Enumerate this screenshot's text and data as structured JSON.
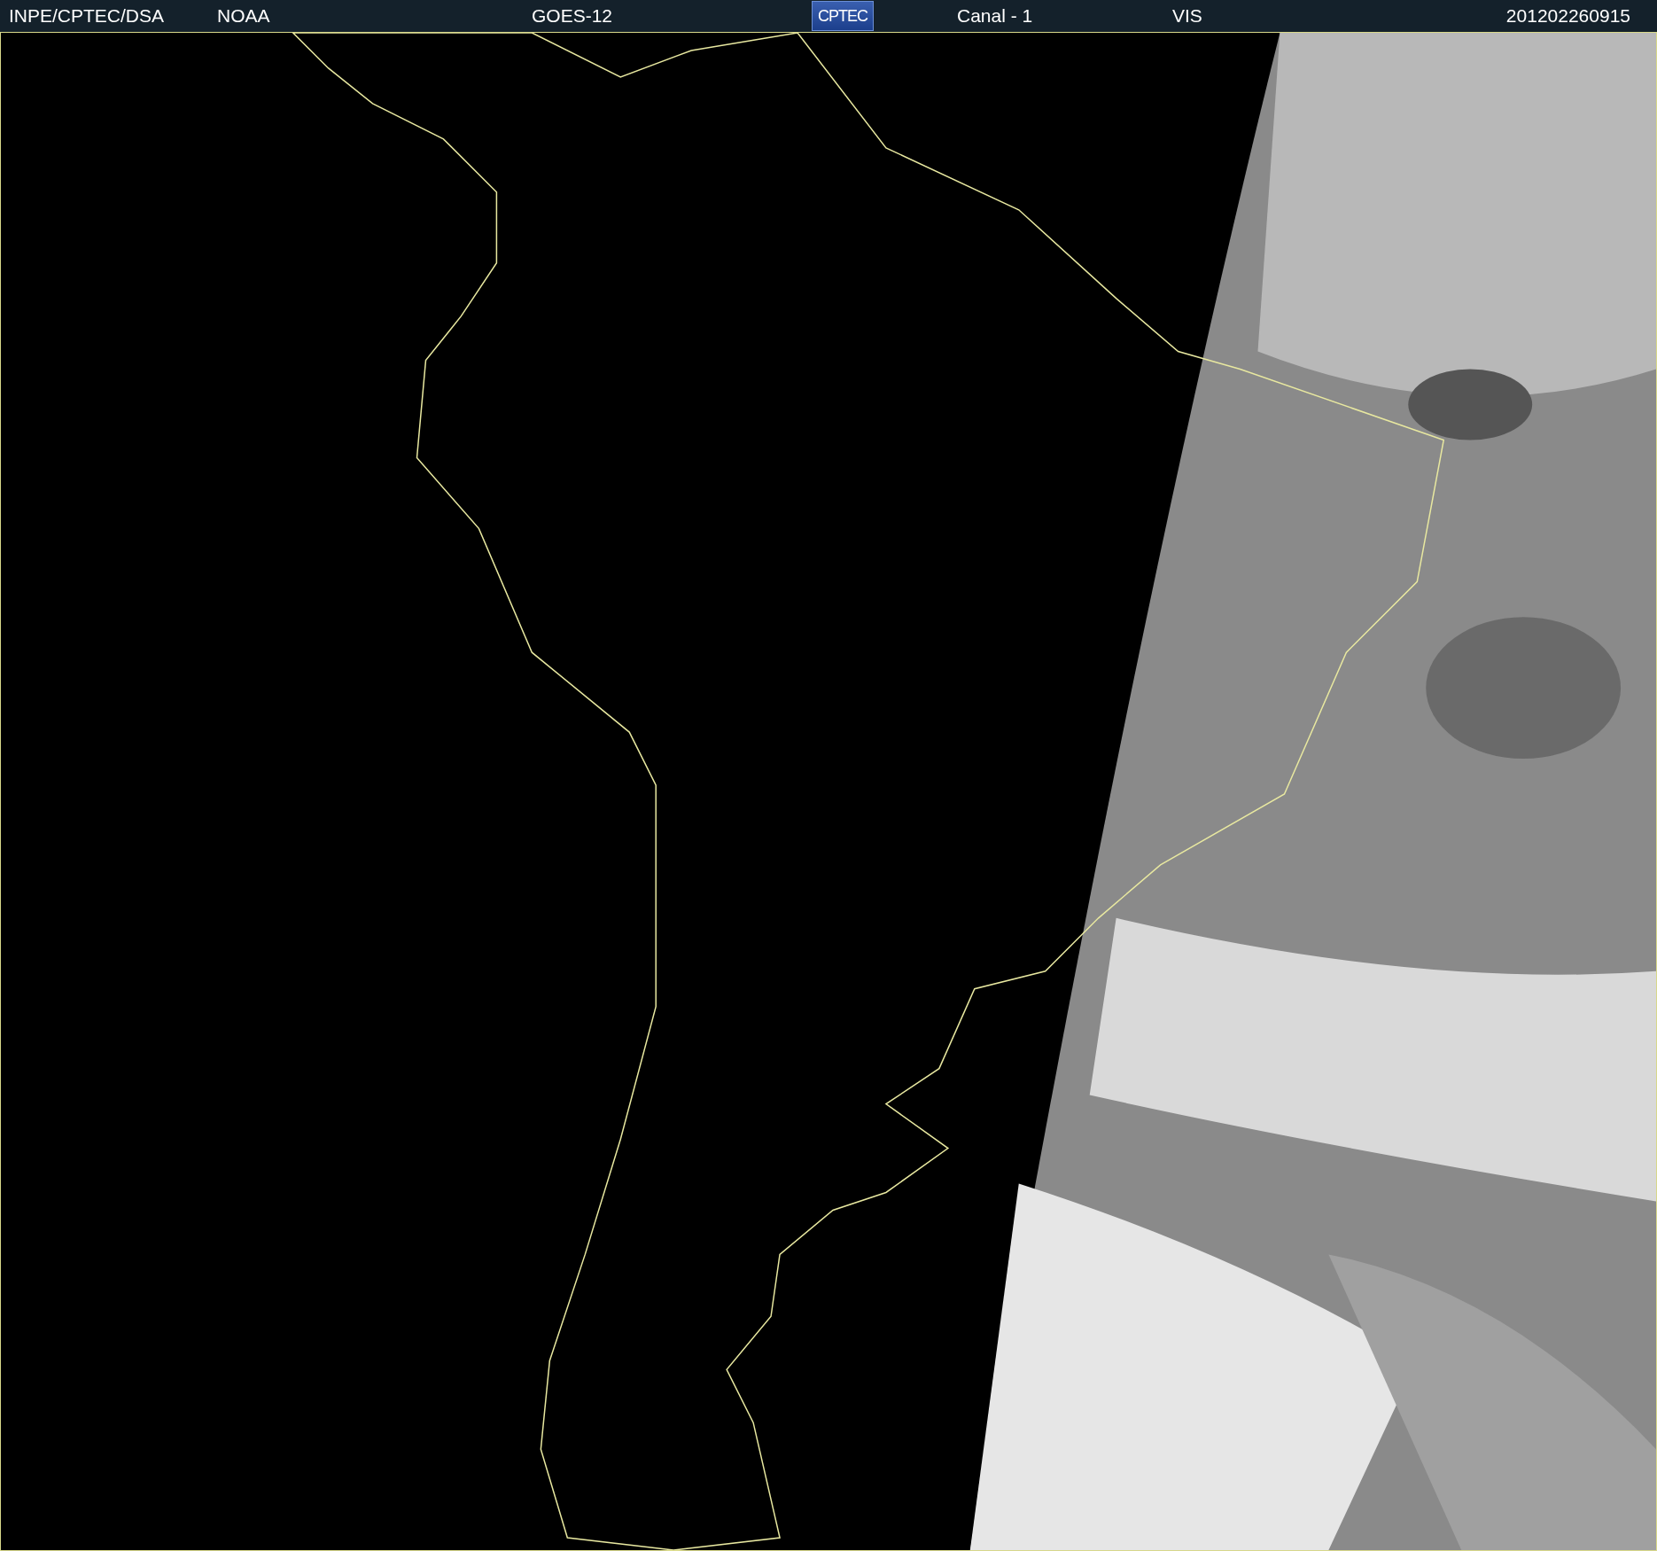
{
  "header": {
    "items": [
      {
        "kind": "text",
        "text": "INPE/CPTEC/DSA"
      },
      {
        "kind": "text",
        "text": "NOAA"
      },
      {
        "kind": "text",
        "text": "GOES-12"
      },
      {
        "kind": "logo",
        "text": "CPTEC"
      },
      {
        "kind": "text",
        "text": "Canal - 1"
      },
      {
        "kind": "text",
        "text": "VIS"
      },
      {
        "kind": "text",
        "text": "201202260915"
      }
    ]
  }
}
